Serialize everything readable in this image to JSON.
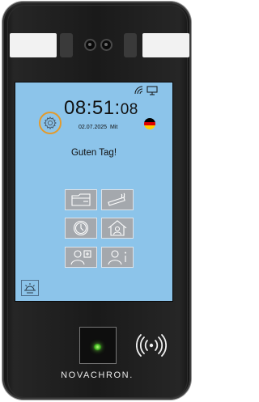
{
  "screen": {
    "time": {
      "hm": "08:51:",
      "sec": "08"
    },
    "date": "02.07.2025",
    "weekday": "Mit",
    "greeting": "Guten Tag!",
    "flag": "germany-flag-icon"
  },
  "brand": {
    "name": "NOVACHRON."
  },
  "colors": {
    "screen_bg": "#8cc4ea",
    "settings_highlight": "#e39a2b",
    "tile_bg": "#a4a8ad",
    "led": "#6ad43a",
    "housing": "#1a1a1a"
  },
  "tiles": [
    {
      "name": "tile-break",
      "icon": "coffee-break-icon"
    },
    {
      "name": "tile-smoke",
      "icon": "cigarette-icon"
    },
    {
      "name": "tile-shift",
      "icon": "clock-icon"
    },
    {
      "name": "tile-home",
      "icon": "home-office-icon"
    },
    {
      "name": "tile-add-user",
      "icon": "add-user-icon"
    },
    {
      "name": "tile-user-info",
      "icon": "user-info-icon"
    }
  ]
}
